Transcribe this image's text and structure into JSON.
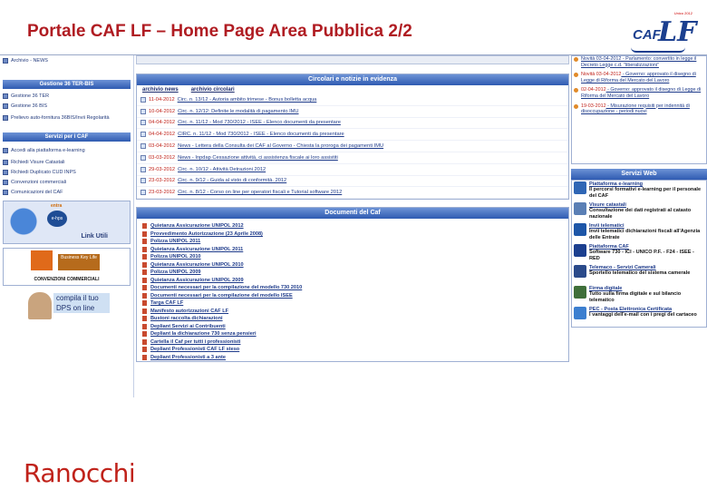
{
  "slide": {
    "title": "Portale CAF LF – Home Page Area Pubblica 2/2",
    "footer": "Ranocchi"
  },
  "logo": {
    "caf": "CAF",
    "lf": "LF",
    "tiny": "Unico 2012"
  },
  "left": {
    "top_item": "Archivio - NEWS",
    "sections": [
      {
        "title": "Gestione 36 TER-BIS",
        "items": [
          "Gestione 36 TER",
          "Gestione 36 BIS",
          "Prelievo auto-fornitura 36BIS/Invii Regolarità"
        ]
      },
      {
        "title": "Servizi per i CAF",
        "items": [
          "Accedi alla piattaforma e-learning",
          "Richiedi Visure Catastali",
          "Richiedi Duplicato CUD INPS",
          "Convenzioni commerciali",
          "Comunicazioni del CAF"
        ]
      }
    ],
    "banners": {
      "link": "Link Utili",
      "link_badge": "e-hps",
      "link_arrow": "entra",
      "business": "Business Key Life",
      "convenzioni": "CONVENZIONI COMMERCIALI",
      "dps": "compila il tuo DPS on line"
    }
  },
  "center": {
    "news_title": "Circolari e notizie in evidenza",
    "tabs": [
      "archivio news",
      "archivio circolari"
    ],
    "news": [
      {
        "date": "11-04-2012",
        "text": "Circ. n. 13/12 - Autoria ambito trimese - Bonus bolletta acqua"
      },
      {
        "date": "10-04-2012",
        "text": "Circ. n. 12/12: Definite le modalità di pagamento IMU"
      },
      {
        "date": "04-04-2012",
        "text": "Circ. n. 11/12 - Mod 730/2012 - ISEE - Elenco documenti da presentare"
      },
      {
        "date": "04-04-2012",
        "text": "CIRC. n. 11/12 - Mod 730/2012 - ISEE - Elenco documenti da presentare"
      },
      {
        "date": "03-04-2012",
        "text": "News - Lettera della Consulta dei CAF al Governo - Chiesta la proroga dei pagamenti IMU"
      },
      {
        "date": "03-03-2012",
        "text": "News - Inpdap Cessazione attività, ci assistenza fiscale ai loro assistiti"
      },
      {
        "date": "29-03-2012",
        "text": "Circ. n. 10/12 - Attività Detrazioni 2012"
      },
      {
        "date": "23-03-2012",
        "text": "Circ. n. 9/12 - Guida al visto di conformità. 2012"
      },
      {
        "date": "23-03-2012",
        "text": "Circ. n. 8/12 - Corso on line per operatori fiscali e Tutorial software 2012"
      }
    ],
    "docs_title": "Documenti del Caf",
    "docs": [
      "Quietanza Assicurazione UNIPOL 2012",
      "Provvedimento Autorizzazione (23 Aprile 2008)",
      "Polizza UNIPOL 2011",
      "Quietanza Assicurazione UNIPOL 2011",
      "Polizza UNIPOL 2010",
      "Quietanza Assicurazione UNIPOL 2010",
      "Polizza UNIPOL 2009",
      "Quietanza Assicurazione UNIPOL 2009",
      "Documenti necessari per la compilazione del modello 730 2010",
      "Documenti necessari per la compilazione del modello ISEE",
      "Targa CAF LF",
      "Manifesto autorizzazioni CAF LF",
      "Bustoni raccolta dichiarazioni",
      "Depliant Servizi ai Contribuenti",
      "Depliant la dichiarazione 730 senza pensieri",
      "Cartella il Caf per tutti i professionisti",
      "Depliant Professionisti CAF LF steso",
      "Depliant Professionisti a 3 ante"
    ]
  },
  "right": {
    "news": [
      {
        "date": "",
        "text": "Novità 03-04-2012 - Parlamento: convertito in legge il Decreto Legge c.d. \"liberalizzazioni\""
      },
      {
        "date": "Novità 03-04-2012",
        "text": " - Governo: approvato il disegno di Legge di Riforma del Mercato del Lavoro"
      },
      {
        "date": "02-04-2012",
        "text": " - Governo: approvato il disegno di Legge di Riforma del Mercato del Lavoro"
      },
      {
        "date": "19-03-2012",
        "text": " - Misurazione requisiti per indennità di disoccupazione - periodi nuovi"
      }
    ],
    "services_title": "Servizi Web",
    "services": [
      {
        "title": "Piattaforma e-learning",
        "desc": "Il percorsi formativi e-learning per il personale del CAF",
        "color": "#2f66b5"
      },
      {
        "title": "Visure catastali",
        "desc": "Consultazione dei dati registrati al catasto nazionale",
        "color": "#5a7fb5"
      },
      {
        "title": "Invii telematici",
        "desc": "Invii telematici dichiarazioni fiscali all'Agenzia delle Entrate",
        "color": "#1d56a8"
      },
      {
        "title": "Piattaforma CAF",
        "desc": "Software 730 - ICI - UNICO P.F. - F24 - ISEE - RED",
        "color": "#1b3f8f"
      },
      {
        "title": "Telemaco - Servizi Camerali",
        "desc": "Sportello telematico del sistema camerale",
        "color": "#2a4a8a"
      },
      {
        "title": "Firma digitale",
        "desc": "Tutto sulla firma digitale e sul bilancio telematico",
        "color": "#3f6f3a"
      },
      {
        "title": "PEC - Posta Elettronica Certificata",
        "desc": "I vantaggi dell'e-mail con i pregi del cartaceo",
        "color": "#3c7fd0"
      }
    ]
  }
}
